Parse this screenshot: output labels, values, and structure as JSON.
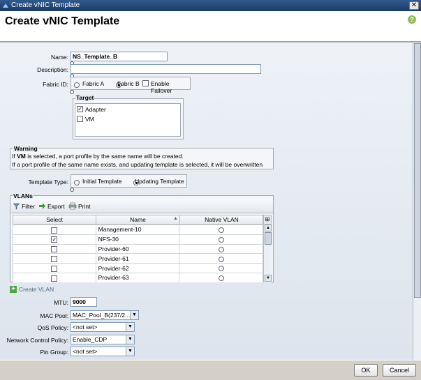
{
  "window": {
    "title": "Create vNIC Template",
    "close_glyph": "✕"
  },
  "header": {
    "title": "Create vNIC Template",
    "help_glyph": "?"
  },
  "form": {
    "name": {
      "label": "Name:",
      "value": "NS_Template_B"
    },
    "description": {
      "label": "Description:",
      "value": ""
    },
    "fabric_id": {
      "label": "Fabric ID:",
      "options": [
        "Fabric A",
        "Fabric B"
      ],
      "selected": "Fabric B",
      "failover_label": "Enable Failover",
      "failover_checked": false
    },
    "target": {
      "legend": "Target",
      "items": [
        {
          "label": "Adapter",
          "checked": true
        },
        {
          "label": "VM",
          "checked": false
        }
      ]
    },
    "warning": {
      "legend": "Warning",
      "line1_pre": "If ",
      "line1_bold": "VM",
      "line1_post": " is selected, a port profile by the same name will be created.",
      "line2": "If a port profile of the same name exists, and updating template is selected, it will be overwritten"
    },
    "template_type": {
      "label": "Template Type:",
      "options": [
        "Initial Template",
        "Updating Template"
      ],
      "selected": "Updating Template"
    },
    "vlans": {
      "legend": "VLANs",
      "toolbar": {
        "filter": "Filter",
        "export": "Export",
        "print": "Print"
      },
      "columns": [
        "Select",
        "Name",
        "Native VLAN"
      ],
      "rows": [
        {
          "name": "Management-10",
          "selected": false
        },
        {
          "name": "NFS-30",
          "selected": true
        },
        {
          "name": "Provider-60",
          "selected": false
        },
        {
          "name": "Provider-61",
          "selected": false
        },
        {
          "name": "Provider-62",
          "selected": false
        },
        {
          "name": "Provider-63",
          "selected": false
        }
      ]
    },
    "create_vlan": "Create VLAN",
    "mtu": {
      "label": "MTU:",
      "value": "9000"
    },
    "mac_pool": {
      "label": "MAC Pool:",
      "value": "MAC_Pool_B(237/2..."
    },
    "qos_policy": {
      "label": "QoS Policy:",
      "value": "<not set>"
    },
    "network_control_policy": {
      "label": "Network Control Policy:",
      "value": "Enable_CDP"
    },
    "pin_group": {
      "label": "Pin Group:",
      "value": "<not set>"
    }
  },
  "footer": {
    "ok": "OK",
    "cancel": "Cancel"
  }
}
